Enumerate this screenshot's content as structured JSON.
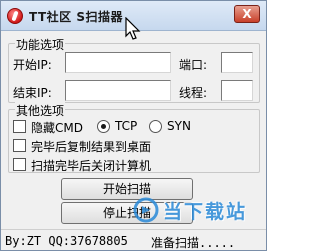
{
  "window": {
    "title": "TT社区 S扫描器",
    "close_label": "X"
  },
  "function_group": {
    "label": "功能选项",
    "start_ip_label": "开始IP:",
    "start_ip_value": "",
    "end_ip_label": "结束IP:",
    "end_ip_value": "",
    "port_label": "端口:",
    "port_value": "",
    "threads_label": "线程:",
    "threads_value": ""
  },
  "other_group": {
    "label": "其他选项",
    "hide_cmd_label": "隐藏CMD",
    "hide_cmd_checked": false,
    "tcp_label": "TCP",
    "tcp_selected": true,
    "syn_label": "SYN",
    "syn_selected": false,
    "copy_result_label": "完毕后复制结果到桌面",
    "copy_result_checked": false,
    "shutdown_label": "扫描完毕后关闭计算机",
    "shutdown_checked": false
  },
  "buttons": {
    "start_label": "开始扫描",
    "stop_label": "停止扫描"
  },
  "status": {
    "author": "By:ZT QQ:37678805",
    "message": "准备扫描....."
  },
  "watermark": {
    "text": "当下载站"
  },
  "colors": {
    "titlebar": "#c6d8ee",
    "close_button": "#c8402a",
    "watermark": "#2a8ad8"
  }
}
